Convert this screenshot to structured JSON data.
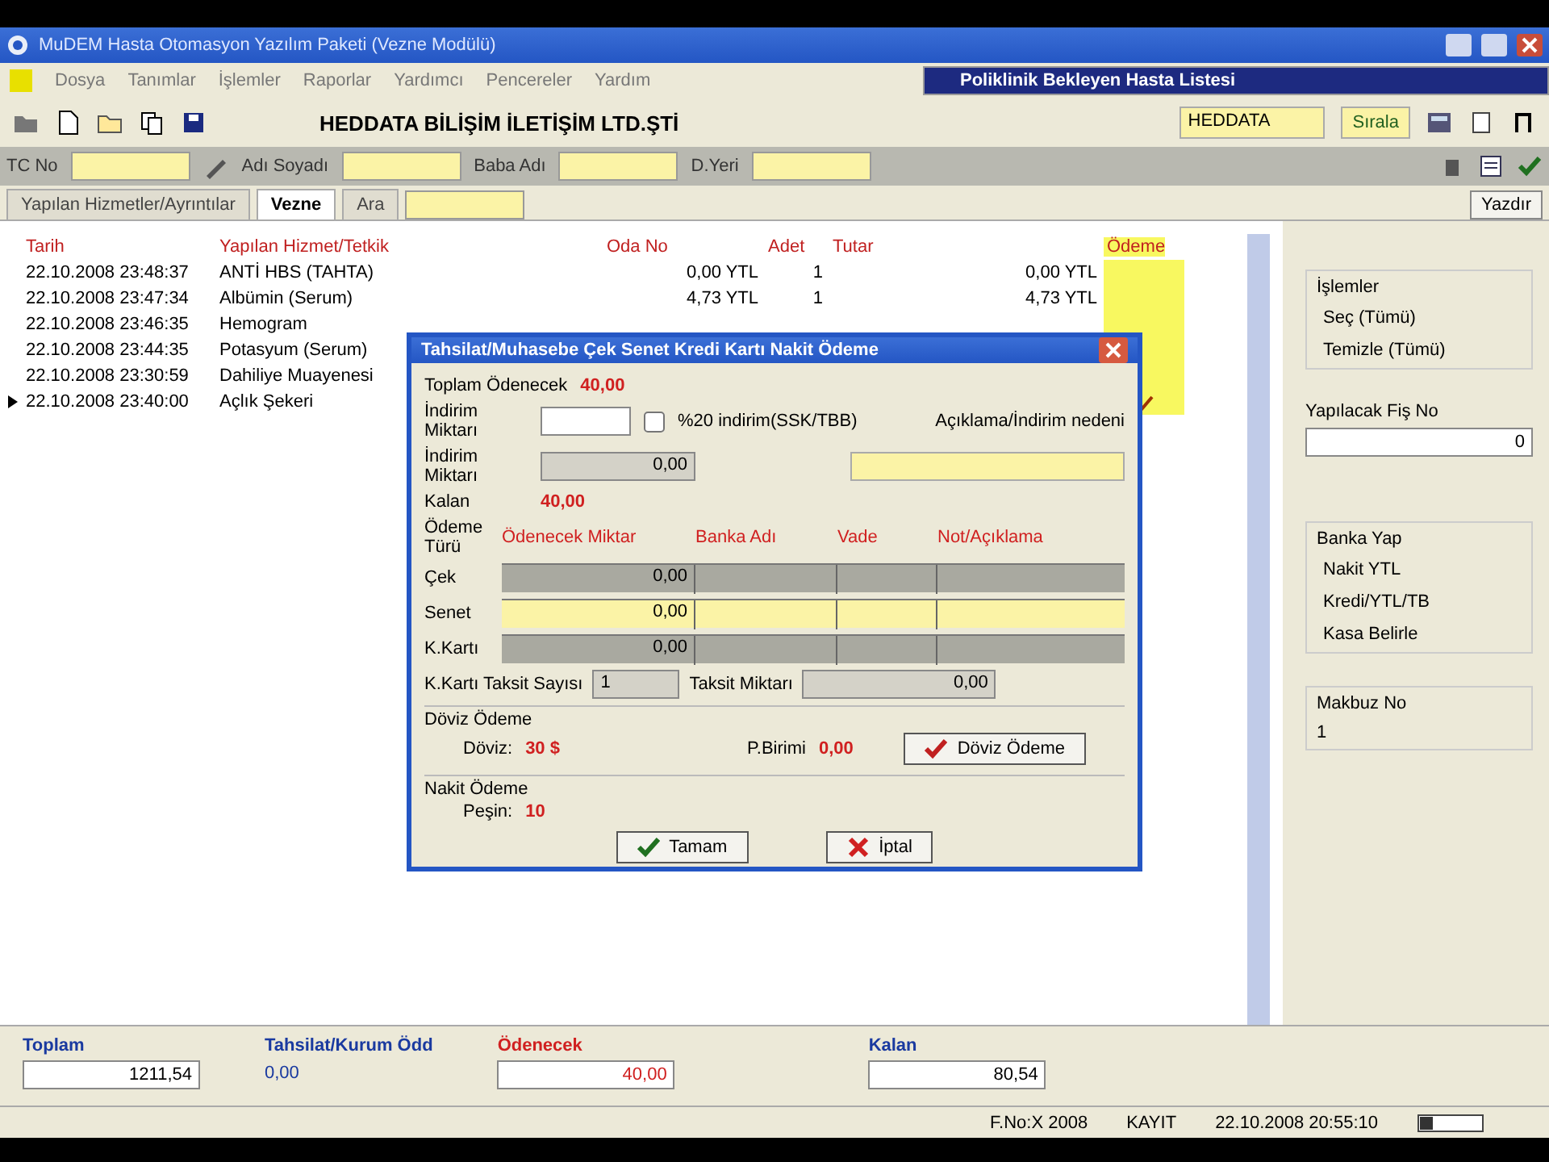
{
  "window": {
    "title": "MuDEM Hasta Otomasyon Yazılım Paketi (Vezne Modülü)"
  },
  "menu": [
    "Dosya",
    "Tanımlar",
    "İşlemler",
    "Raporlar",
    "Yardımcı",
    "Pencereler",
    "Yardım"
  ],
  "popup_window": {
    "title": "Poliklinik Bekleyen Hasta Listesi"
  },
  "toolbar": {
    "company": "HEDDATA BİLİŞİM İLETİŞİM LTD.ŞTİ",
    "user_field": {
      "value": "HEDDATA"
    },
    "search_button": "Sırala"
  },
  "patient_bar": {
    "fields": [
      {
        "label": "TC No"
      },
      {
        "label": "Adı Soyadı"
      },
      {
        "label": "Baba Adı"
      },
      {
        "label": "D.Yeri"
      }
    ]
  },
  "tabs": [
    {
      "label": "Yapılan Hizmetler/Ayrıntılar",
      "selected": false
    },
    {
      "label": "Vezne",
      "selected": true
    },
    {
      "label": "Ara",
      "selected": false
    }
  ],
  "print_button": "Yazdır",
  "table": {
    "columns": [
      "Tarih",
      "Yapılan Hizmet/Tetkik",
      "Oda No",
      "Adet",
      "Tutar",
      "Ödeme"
    ],
    "rows": [
      {
        "cells": [
          "22.10.2008 23:48:37",
          "ANTİ HBS (TAHTA)",
          "0,00 YTL",
          "1",
          "0,00 YTL"
        ],
        "selected": false,
        "paid": false
      },
      {
        "cells": [
          "22.10.2008 23:47:34",
          "Albümin (Serum)",
          "4,73 YTL",
          "1",
          "4,73 YTL"
        ],
        "selected": false,
        "paid": false
      },
      {
        "cells": [
          "22.10.2008 23:46:35",
          "Hemogram"
        ],
        "selected": false,
        "paid": false
      },
      {
        "cells": [
          "22.10.2008 23:44:35",
          "Potasyum (Serum)"
        ],
        "selected": false,
        "paid": false
      },
      {
        "cells": [
          "22.10.2008 23:30:59",
          "Dahiliye Muayenesi"
        ],
        "selected": false,
        "paid": false
      },
      {
        "cells": [
          "22.10.2008 23:40:00",
          "Açlık Şekeri"
        ],
        "selected": true,
        "paid": true
      }
    ]
  },
  "side_panel": {
    "groups": [
      {
        "title": "İşlemler",
        "items": [
          "Seç (Tümü)",
          "Temizle (Tümü)"
        ]
      }
    ],
    "receipt": {
      "label": "Yapılacak Fiş No",
      "value": "0"
    },
    "bank": {
      "title": "Banka Yap",
      "items": [
        "Nakit YTL",
        "Kredi/YTL/TB",
        "Kasa Belirle"
      ]
    },
    "makbuz": {
      "label": "Makbuz No",
      "value": "1"
    }
  },
  "dialog": {
    "title": "Tahsilat/Muhasebe Çek Senet Kredi Kartı Nakit Ödeme",
    "total": {
      "label": "Toplam Ödenecek",
      "value": "40,00"
    },
    "discount_label": "İndirim Miktarı",
    "discount_check": {
      "label": "%20 indirim(SSK/TBB)",
      "checked": false
    },
    "discount_amount": {
      "label": "İndirim Miktarı",
      "value": "0,00"
    },
    "note_label": "Açıklama/İndirim nedeni",
    "remaining": {
      "label": "Kalan",
      "value": "40,00"
    },
    "pay_headers": [
      "Ödeme Türü",
      "Ödenecek Miktar",
      "Banka Adı",
      "Vade",
      "Not/Açıklama"
    ],
    "pay_rows": [
      {
        "label": "Çek",
        "amount": "0,00",
        "selected": false
      },
      {
        "label": "Senet",
        "amount": "0,00",
        "selected": true
      },
      {
        "label": "K.Kartı",
        "amount": "0,00",
        "selected": false
      }
    ],
    "installments": {
      "label": "K.Kartı Taksit Sayısı",
      "value": "1"
    },
    "installment_amount": {
      "label": "Taksit Miktarı",
      "value": "0,00"
    },
    "currency": {
      "title": "Döviz Ödeme",
      "items": [
        {
          "label": "Döviz:",
          "value": "30 $"
        },
        {
          "label": "P.Birimi",
          "value": "0,00"
        }
      ],
      "button": "Döviz Ödeme"
    },
    "cash": {
      "title": "Nakit Ödeme",
      "label": "Peşin:",
      "value": "10"
    },
    "buttons": [
      {
        "label": "Tamam",
        "kind": "ok"
      },
      {
        "label": "İptal",
        "kind": "cancel"
      }
    ]
  },
  "totals": [
    {
      "label": "Toplam",
      "value": "1211,54",
      "kind": "box"
    },
    {
      "label": "Tahsilat/Kurum Ödd",
      "value": "0,00",
      "kind": "plain"
    },
    {
      "label": "Ödenecek",
      "value": "40,00",
      "kind": "red"
    },
    {
      "label": "Kalan",
      "value": "80,54",
      "kind": "box"
    }
  ],
  "status_bar": [
    "F.No:X 2008",
    "KAYIT",
    "22.10.2008 20:55:10"
  ]
}
